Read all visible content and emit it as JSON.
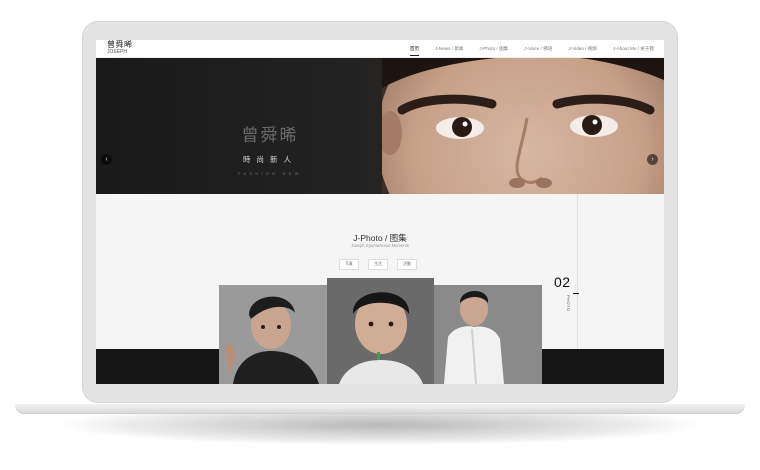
{
  "site": {
    "logo_cn": "曾舜晞",
    "logo_en": "JOSEPH"
  },
  "nav": {
    "items": [
      {
        "label": "首页",
        "active": true
      },
      {
        "label": "J-News / 新闻",
        "active": false
      },
      {
        "label": "J-Photo / 图集",
        "active": false
      },
      {
        "label": "J-Voice / 佛语",
        "active": false
      },
      {
        "label": "J-Video / 视频",
        "active": false
      },
      {
        "label": "J-About Me / 关于我",
        "active": false
      }
    ]
  },
  "hero": {
    "title": "曾舜晞",
    "subtitle": "時尚新人",
    "subtitle_en": "FASHION NEW",
    "prev_icon": "‹",
    "next_icon": "›"
  },
  "gallery": {
    "title": "J-Photo / 图集",
    "subtitle": "Joseph Spontaneous Moments",
    "filters": [
      "写真",
      "生活",
      "活動"
    ],
    "number": "02",
    "number_label": "PHOTO"
  },
  "colors": {
    "hero_bg": "#1c1c1c",
    "section_bg": "#f5f5f5",
    "accent": "#111111"
  }
}
